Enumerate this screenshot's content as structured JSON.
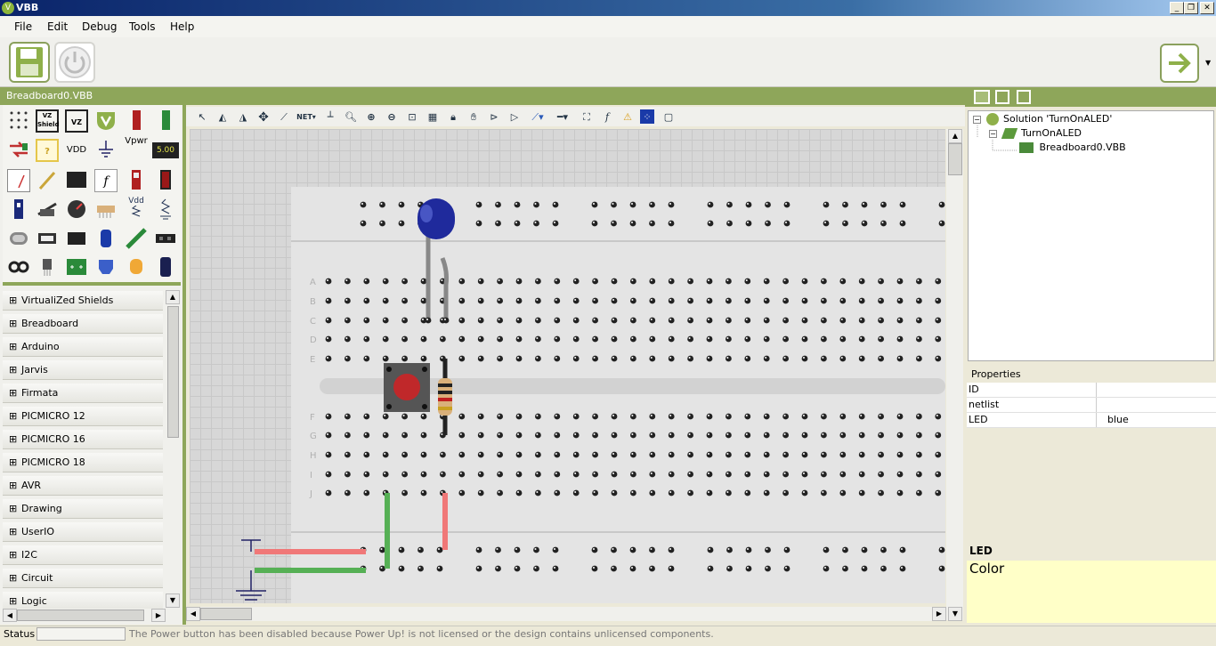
{
  "window": {
    "title": "VBB",
    "icon_letter": "V",
    "controls": [
      "_",
      "❐",
      "✕"
    ]
  },
  "menu": [
    "File",
    "Edit",
    "Debug",
    "Tools",
    "Help"
  ],
  "document_tab": "Breadboard0.VBB",
  "palette": {
    "labels": {
      "vdd": "VDD",
      "vpwr": "Vpwr",
      "num": "5.00",
      "vdd_small": "Vdd",
      "shield1": "VZ Shield",
      "help": "?"
    }
  },
  "categories": [
    "VirtualiZed Shields",
    "Breadboard",
    "Arduino",
    "Jarvis",
    "Firmata",
    "PICMICRO 12",
    "PICMICRO 16",
    "PICMICRO 18",
    "AVR",
    "Drawing",
    "UserIO",
    "I2C",
    "Circuit",
    "Logic"
  ],
  "canvas_toolbar": {
    "net_label": "NET"
  },
  "breadboard": {
    "rows_top": [
      "A",
      "B",
      "C",
      "D",
      "E"
    ],
    "rows_bottom": [
      "F",
      "G",
      "H",
      "I",
      "J"
    ],
    "led_color": "#1f2a9c"
  },
  "solution_tree": {
    "solution": "Solution 'TurnOnALED'",
    "project": "TurnOnALED",
    "file": "Breadboard0.VBB"
  },
  "properties": {
    "header": "Properties",
    "rows": [
      {
        "name": "ID",
        "value": ""
      },
      {
        "name": "netlist",
        "value": ""
      },
      {
        "name": "LED",
        "value": "blue"
      }
    ]
  },
  "description": {
    "title": "LED",
    "text": "Color"
  },
  "status": {
    "label": "Status",
    "message": "The Power button has been disabled because Power Up! is not licensed or the design contains unlicensed components."
  },
  "colors": {
    "accent": "#8ea65a",
    "wire_red": "#f07878",
    "wire_green": "#56b055"
  }
}
